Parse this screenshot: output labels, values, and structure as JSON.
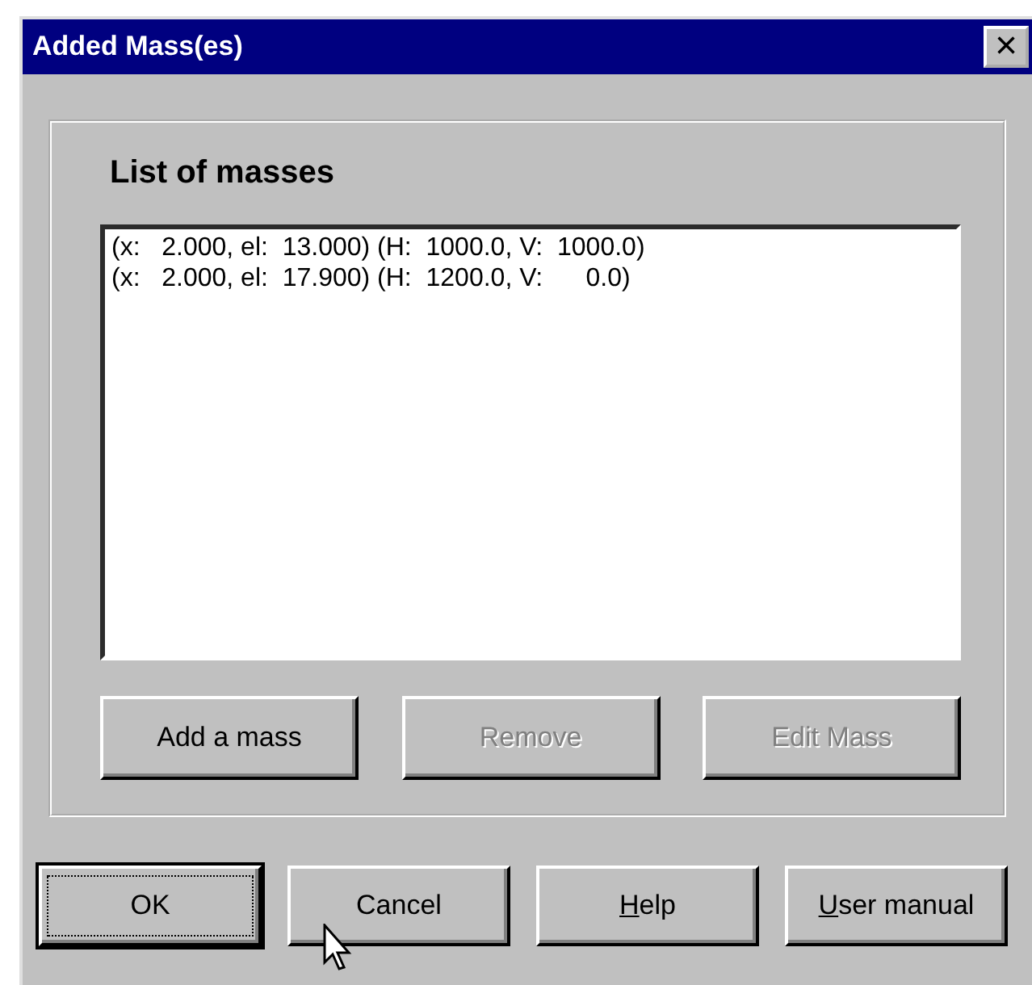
{
  "window": {
    "title": "Added Mass(es)",
    "close_label": "×"
  },
  "group": {
    "title": "List of masses",
    "list": {
      "rows": [
        {
          "text": "(x:   2.000, el:  13.000) (H:  1000.0, V:  1000.0)",
          "selected": false
        },
        {
          "text": "(x:   2.000, el:  17.900) (H:  1200.0, V:      0.0)",
          "selected": false
        }
      ]
    },
    "buttons": [
      {
        "label": "Add a mass",
        "disabled": false
      },
      {
        "label": "Remove",
        "disabled": true
      },
      {
        "label": "Edit Mass",
        "disabled": true
      }
    ]
  },
  "dialog_buttons": [
    {
      "label": "OK",
      "default": true,
      "mnemonic": false
    },
    {
      "label": "Cancel",
      "default": false,
      "mnemonic": false
    },
    {
      "label": "Help",
      "default": false,
      "mnemonic": true
    },
    {
      "label": "User manual",
      "default": false,
      "mnemonic": true
    }
  ]
}
